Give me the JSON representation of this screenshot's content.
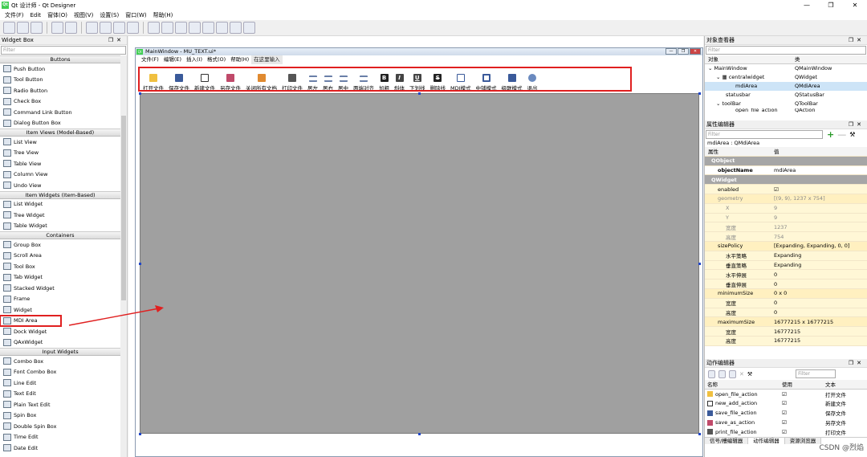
{
  "app": {
    "title": "Qt 设计师 - Qt Designer",
    "logo": "Qt",
    "win_min": "—",
    "win_max": "❐",
    "win_close": "✕"
  },
  "menu": [
    "文件(F)",
    "Edit",
    "窗体(O)",
    "视图(V)",
    "设置(S)",
    "窗口(W)",
    "帮助(H)"
  ],
  "widget_box": {
    "title": "Widget Box",
    "filter_placeholder": "Filter",
    "groups": [
      {
        "label": "Buttons",
        "items": [
          "Push Button",
          "Tool Button",
          "Radio Button",
          "Check Box",
          "Command Link Button",
          "Dialog Button Box"
        ]
      },
      {
        "label": "Item Views (Model-Based)",
        "items": [
          "List View",
          "Tree View",
          "Table View",
          "Column View",
          "Undo View"
        ]
      },
      {
        "label": "Item Widgets (Item-Based)",
        "items": [
          "List Widget",
          "Tree Widget",
          "Table Widget"
        ]
      },
      {
        "label": "Containers",
        "items": [
          "Group Box",
          "Scroll Area",
          "Tool Box",
          "Tab Widget",
          "Stacked Widget",
          "Frame",
          "Widget",
          "MDI Area",
          "Dock Widget",
          "QAxWidget"
        ]
      },
      {
        "label": "Input Widgets",
        "items": [
          "Combo Box",
          "Font Combo Box",
          "Line Edit",
          "Text Edit",
          "Plain Text Edit",
          "Spin Box",
          "Double Spin Box",
          "Time Edit",
          "Date Edit"
        ]
      }
    ]
  },
  "form": {
    "title": "MainWindow - MU_TEXT.ui*",
    "logo": "Qt",
    "menu": [
      "文件(F)",
      "编辑(E)",
      "插入(I)",
      "格式(O)",
      "帮助(H)"
    ],
    "menu_placeholder": "在这里输入",
    "actions": [
      "打开文件",
      "保存文件",
      "新建文件",
      "另存文件",
      "关闭所有文档",
      "打印文件",
      "居左",
      "居右",
      "居中",
      "两端对齐",
      "加粗",
      "斜体",
      "下划线",
      "删除线",
      "MDI模式",
      "中铺模式",
      "级联模式",
      "退出"
    ],
    "bold_glyphs": [
      "B",
      "I",
      "U",
      "S"
    ]
  },
  "object_inspector": {
    "title": "对象查看器",
    "filter_placeholder": "Filter",
    "headers": [
      "对象",
      "类"
    ],
    "rows": [
      {
        "obj": "MainWindow",
        "cls": "QMainWindow"
      },
      {
        "obj": "centralwidget",
        "cls": "QWidget"
      },
      {
        "obj": "mdiArea",
        "cls": "QMdiArea"
      },
      {
        "obj": "statusbar",
        "cls": "QStatusBar"
      },
      {
        "obj": "toolBar",
        "cls": "QToolBar"
      },
      {
        "obj": "open_file_action",
        "cls": "QAction"
      }
    ]
  },
  "property_editor": {
    "title": "属性编辑器",
    "filter_placeholder": "Filter",
    "context": "mdiArea : QMdiArea",
    "headers": [
      "属性",
      "值"
    ],
    "rows": [
      {
        "k": "QObject",
        "v": "",
        "type": "grp"
      },
      {
        "k": "objectName",
        "v": "mdiArea",
        "type": "bold"
      },
      {
        "k": "QWidget",
        "v": "",
        "type": "grp"
      },
      {
        "k": "enabled",
        "v": "☑",
        "type": "y"
      },
      {
        "k": "geometry",
        "v": "[(9, 9), 1237 x 754]",
        "type": "y2 dim"
      },
      {
        "k": "X",
        "v": "9",
        "type": "y dim"
      },
      {
        "k": "Y",
        "v": "9",
        "type": "y dim"
      },
      {
        "k": "宽度",
        "v": "1237",
        "type": "y dim"
      },
      {
        "k": "高度",
        "v": "754",
        "type": "y dim"
      },
      {
        "k": "sizePolicy",
        "v": "[Expanding, Expanding, 0, 0]",
        "type": "y2"
      },
      {
        "k": "水平策略",
        "v": "Expanding",
        "type": "y"
      },
      {
        "k": "垂直策略",
        "v": "Expanding",
        "type": "y"
      },
      {
        "k": "水平伸展",
        "v": "0",
        "type": "y"
      },
      {
        "k": "垂直伸展",
        "v": "0",
        "type": "y"
      },
      {
        "k": "minimumSize",
        "v": "0 x 0",
        "type": "y2"
      },
      {
        "k": "宽度",
        "v": "0",
        "type": "y"
      },
      {
        "k": "高度",
        "v": "0",
        "type": "y"
      },
      {
        "k": "maximumSize",
        "v": "16777215 x 16777215",
        "type": "y2"
      },
      {
        "k": "宽度",
        "v": "16777215",
        "type": "y"
      },
      {
        "k": "高度",
        "v": "16777215",
        "type": "y"
      }
    ]
  },
  "action_editor": {
    "title": "动作编辑器",
    "filter_placeholder": "Filter",
    "headers": [
      "名称",
      "使用",
      "文本"
    ],
    "rows": [
      {
        "name": "open_file_action",
        "used": "☑",
        "text": "打开文件"
      },
      {
        "name": "new_add_action",
        "used": "☑",
        "text": "新建文件"
      },
      {
        "name": "save_file_action",
        "used": "☑",
        "text": "保存文件"
      },
      {
        "name": "save_as_action",
        "used": "☑",
        "text": "另存文件"
      },
      {
        "name": "print_file_action",
        "used": "☑",
        "text": "打印文件"
      }
    ],
    "tabs": [
      "信号/槽编辑器",
      "动作编辑器",
      "资源浏览器"
    ]
  },
  "watermark": "CSDN @烈焰",
  "colors": {
    "highlight_red": "#e02020",
    "mdi_gray": "#a0a0a0",
    "group_gray": "#a6a6a6"
  }
}
